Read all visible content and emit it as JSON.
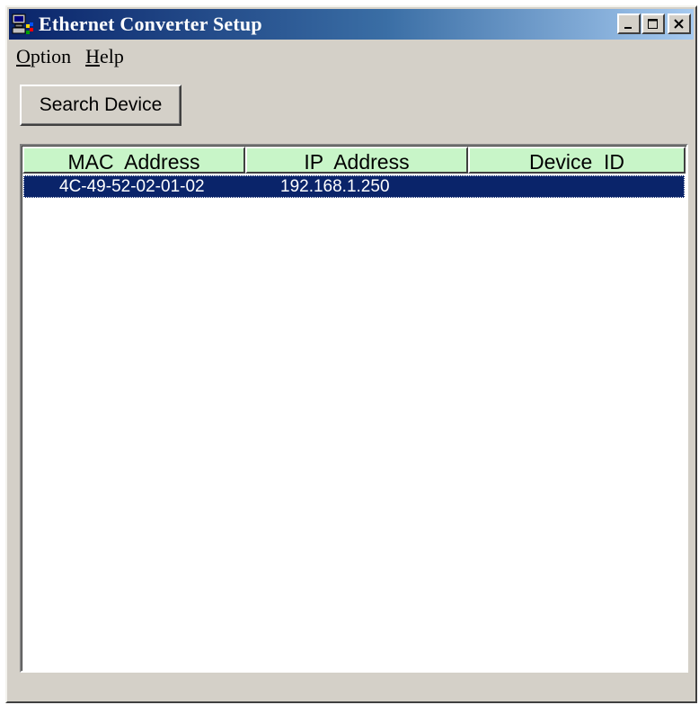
{
  "window": {
    "title": "Ethernet Converter Setup"
  },
  "title_controls": {
    "minimize_icon": "minimize-icon",
    "maximize_icon": "maximize-icon",
    "close_icon": "close-icon"
  },
  "menu": {
    "items": [
      {
        "mnemonic": "O",
        "rest": "ption"
      },
      {
        "mnemonic": "H",
        "rest": "elp"
      }
    ]
  },
  "toolbar": {
    "search_label": "Search Device"
  },
  "table": {
    "columns": [
      "MAC  Address",
      "IP  Address",
      "Device  ID"
    ],
    "rows": [
      {
        "mac": "4C-49-52-02-01-02",
        "ip": "192.168.1.250",
        "device_id": "",
        "selected": true
      }
    ]
  },
  "colors": {
    "title_start": "#0a246a",
    "title_end": "#a6caf0",
    "header_bg": "#c8f5c8",
    "selection_bg": "#0a246a",
    "window_bg": "#d4d0c8"
  }
}
